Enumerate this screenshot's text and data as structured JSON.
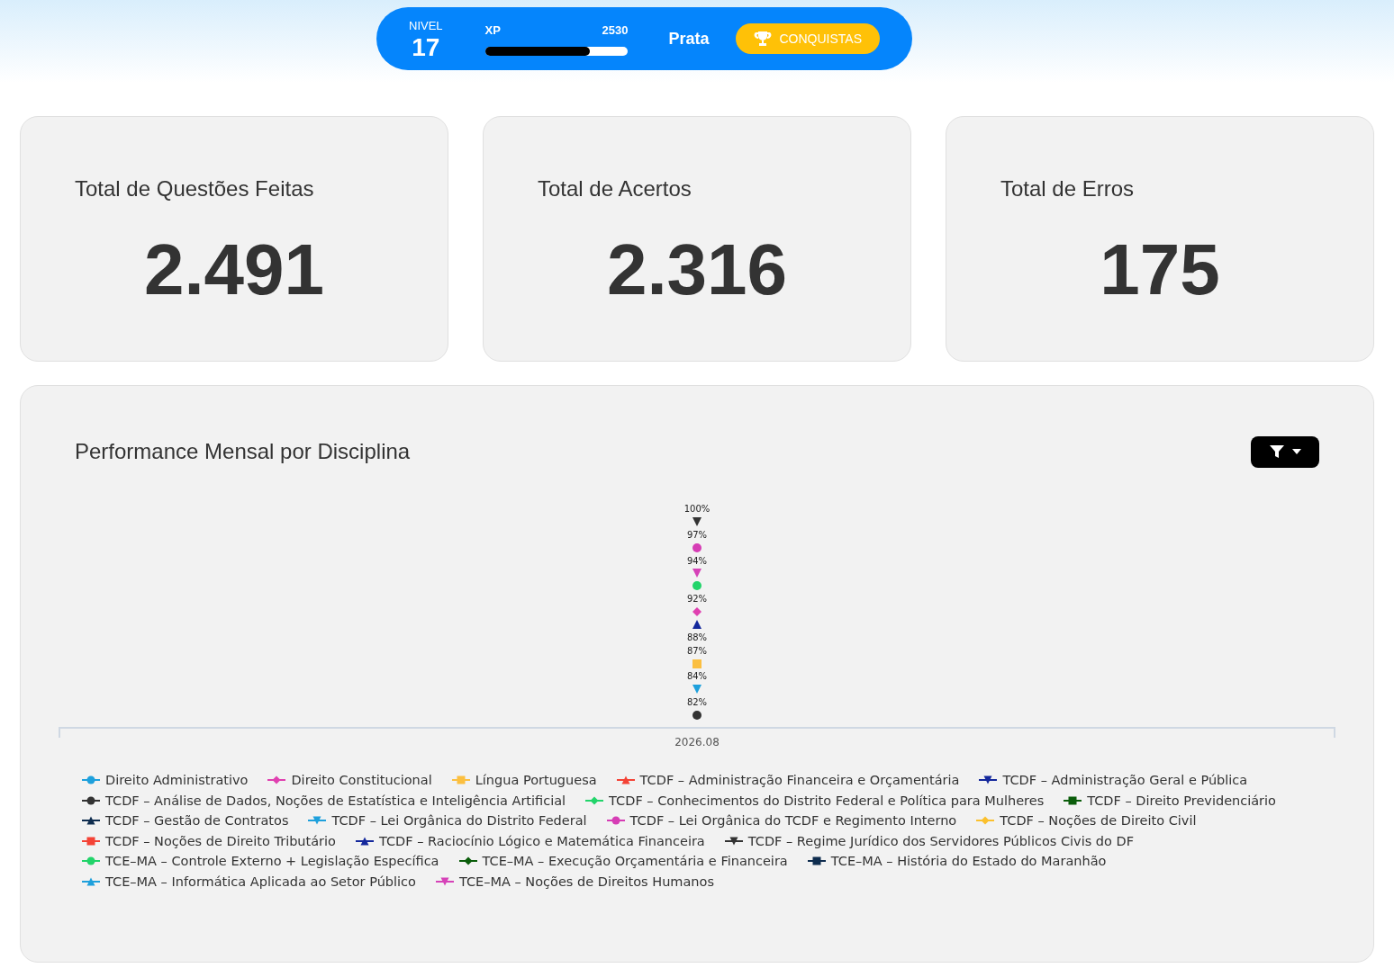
{
  "level_bar": {
    "level_label": "NIVEL",
    "level_value": "17",
    "xp_label": "XP",
    "xp_value": "2530",
    "level": 0.735,
    "rank": "Prata",
    "achievements_button": "CONQUISTAS"
  },
  "stats": [
    {
      "title": "Total de Questões Feitas",
      "value": "2.491"
    },
    {
      "title": "Total de Acertos",
      "value": "2.316"
    },
    {
      "title": "Total de Erros",
      "value": "175"
    }
  ],
  "performance": {
    "title": "Performance Mensal por Disciplina",
    "plot": [
      {
        "kind": "label",
        "label": "100%"
      },
      {
        "kind": "triangle-down",
        "color": "#333333"
      },
      {
        "kind": "label",
        "label": "97%"
      },
      {
        "kind": "circle",
        "color": "#d63db5"
      },
      {
        "kind": "label",
        "label": "94%"
      },
      {
        "kind": "triangle-down",
        "color": "#d642b8"
      },
      {
        "kind": "circle",
        "color": "#22d46a"
      },
      {
        "kind": "label",
        "label": "92%"
      },
      {
        "kind": "diamond",
        "color": "#e040b0"
      },
      {
        "kind": "triangle",
        "color": "#14289c"
      },
      {
        "kind": "label",
        "label": "88%"
      },
      {
        "kind": "label",
        "label": "87%"
      },
      {
        "kind": "square",
        "color": "#fbbf40"
      },
      {
        "kind": "label",
        "label": "84%"
      },
      {
        "kind": "triangle-down",
        "color": "#1ea0dc"
      },
      {
        "kind": "label",
        "label": "82%"
      },
      {
        "kind": "circle",
        "color": "#333333"
      }
    ],
    "x_category": "2026.08",
    "legend": [
      {
        "name": "Direito Administrativo",
        "color": "#1ea0dc",
        "kind": "circle"
      },
      {
        "name": "Direito Constitucional",
        "color": "#e040b0",
        "kind": "diamond"
      },
      {
        "name": "Língua Portuguesa",
        "color": "#fbbf40",
        "kind": "square"
      },
      {
        "name": "TCDF – Administração Financeira e Orçamentária",
        "color": "#f44336",
        "kind": "triangle"
      },
      {
        "name": "TCDF – Administração Geral e Pública",
        "color": "#14289c",
        "kind": "triangle-down"
      },
      {
        "name": "TCDF – Análise de Dados, Noções de Estatística e Inteligência Artificial",
        "color": "#333333",
        "kind": "circle"
      },
      {
        "name": "TCDF – Conhecimentos do Distrito Federal e Política para Mulheres",
        "color": "#22d46a",
        "kind": "diamond"
      },
      {
        "name": "TCDF – Direito Previdenciário",
        "color": "#0b5d0b",
        "kind": "square"
      },
      {
        "name": "TCDF – Gestão de Contratos",
        "color": "#0f2d4f",
        "kind": "triangle"
      },
      {
        "name": "TCDF – Lei Orgânica do Distrito Federal",
        "color": "#1ea0dc",
        "kind": "triangle-down"
      },
      {
        "name": "TCDF – Lei Orgânica do TCDF e Regimento Interno",
        "color": "#d63db5",
        "kind": "circle"
      },
      {
        "name": "TCDF – Noções de Direito Civil",
        "color": "#fbc02d",
        "kind": "diamond"
      },
      {
        "name": "TCDF – Noções de Direito Tributário",
        "color": "#f44336",
        "kind": "square"
      },
      {
        "name": "TCDF – Raciocínio Lógico e Matemática Financeira",
        "color": "#14289c",
        "kind": "triangle"
      },
      {
        "name": "TCDF – Regime Jurídico dos Servidores Públicos Civis do DF",
        "color": "#333333",
        "kind": "triangle-down"
      },
      {
        "name": "TCE–MA – Controle Externo + Legislação Específica",
        "color": "#22d46a",
        "kind": "circle"
      },
      {
        "name": "TCE–MA – Execução Orçamentária e Financeira",
        "color": "#0b5d0b",
        "kind": "diamond"
      },
      {
        "name": "TCE–MA – História do Estado do Maranhão",
        "color": "#0f2d4f",
        "kind": "square"
      },
      {
        "name": "TCE–MA – Informática Aplicada ao Setor Público",
        "color": "#1ea0dc",
        "kind": "triangle"
      },
      {
        "name": "TCE–MA – Noções de Direitos Humanos",
        "color": "#d642b8",
        "kind": "triangle-down"
      }
    ]
  }
}
